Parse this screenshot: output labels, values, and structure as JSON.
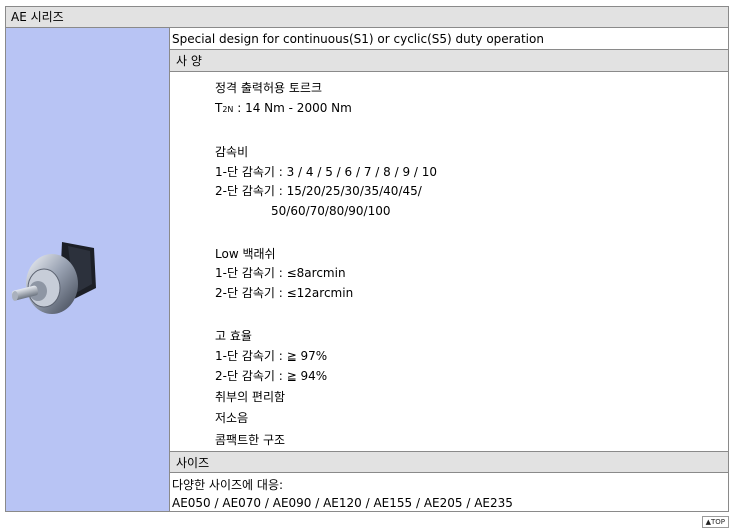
{
  "title": "AE 시리즈",
  "headline": "Special design for continuous(S1) or cyclic(S5) duty operation",
  "spec_section": {
    "heading": "사 양",
    "torque_title": "정격 출력허용 토르크",
    "torque_symbol": "T",
    "torque_sub": "2N",
    "torque_value": " : 14 Nm - 2000 Nm",
    "ratio_title": "감속비",
    "ratio_1stage": "1-단 감속기 : 3 / 4 / 5 / 6 / 7 / 8 / 9 / 10",
    "ratio_2stage_a": "2-단 감속기 : 15/20/25/30/35/40/45/",
    "ratio_2stage_b": "50/60/70/80/90/100",
    "backlash_title": "Low 백래쉬",
    "backlash_1stage": "1-단 감속기 : ≤8arcmin",
    "backlash_2stage": "2-단 감속기 : ≤12arcmin",
    "efficiency_title": "고 효율",
    "efficiency_1stage": "1-단 감속기 : ≧ 97%",
    "efficiency_2stage": "2-단 감속기 : ≧ 94%",
    "feature_1": "취부의 편리함",
    "feature_2": "저소음",
    "feature_3": "콤팩트한 구조"
  },
  "size_section": {
    "heading": "사이즈",
    "intro": "다양한 사이즈에 대응:",
    "models": "AE050 / AE070 / AE090 / AE120 / AE155 / AE205 / AE235"
  },
  "top_link": "▲TOP",
  "colors": {
    "left_panel": "#b8c4f4",
    "header_bg": "#e2e2e2",
    "border": "#8a8a8a"
  }
}
